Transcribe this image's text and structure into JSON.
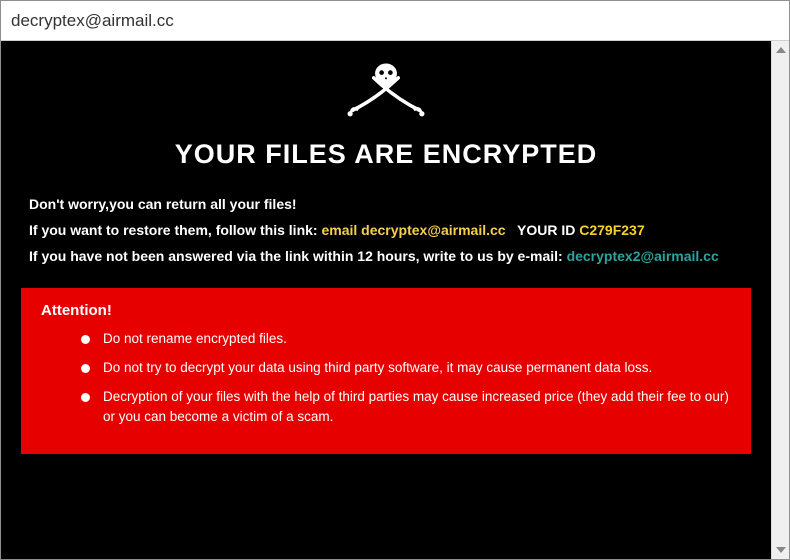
{
  "window": {
    "title": "decryptex@airmail.cc"
  },
  "headline": "YOUR FILES ARE ENCRYPTED",
  "body": {
    "line1": "Don't worry,you can return all your files!",
    "line2a": "If you want to restore them, follow this link:",
    "line2_email_label": "email",
    "line2_email": "decryptex@airmail.cc",
    "line2_id_label": "YOUR ID",
    "line2_id": "C279F237",
    "line3a": "If you have not been answered via the link within 12 hours, write to us by e-mail:",
    "line3_email": "decryptex2@airmail.cc"
  },
  "attention": {
    "title": "Attention!",
    "items": [
      "Do not rename encrypted files.",
      "Do not try to decrypt your data using third party software, it may cause permanent data loss.",
      "Decryption of your files with the help of third parties may cause increased price (they add their fee to our) or you can become a victim of a scam."
    ]
  }
}
